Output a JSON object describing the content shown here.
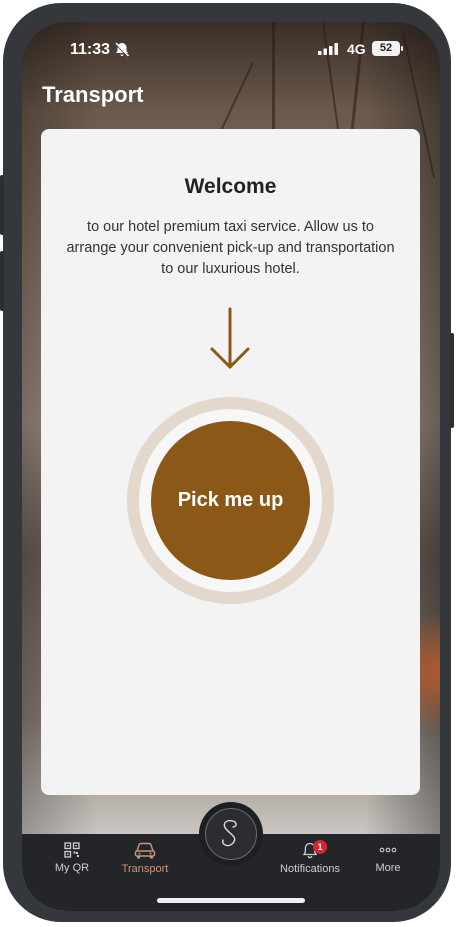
{
  "status_bar": {
    "time": "11:33",
    "network": "4G",
    "battery": "52"
  },
  "header": {
    "title": "Transport"
  },
  "card": {
    "heading": "Welcome",
    "description": "to our hotel premium taxi service. Allow us to arrange your convenient pick-up and transportation to our luxurious hotel.",
    "button_label": "Pick me up"
  },
  "tabbar": {
    "items": [
      {
        "label": "My QR",
        "icon": "qr-code-icon"
      },
      {
        "label": "Transport",
        "icon": "car-icon"
      },
      {
        "label": "Notifications",
        "icon": "bell-icon"
      },
      {
        "label": "More",
        "icon": "more-dots-icon"
      }
    ],
    "center_logo": "S",
    "notifications_badge": "1"
  },
  "colors": {
    "accent": "#8c5818",
    "ring": "#e4d8cc",
    "tab_active": "#c9977a",
    "badge": "#d8262c"
  }
}
